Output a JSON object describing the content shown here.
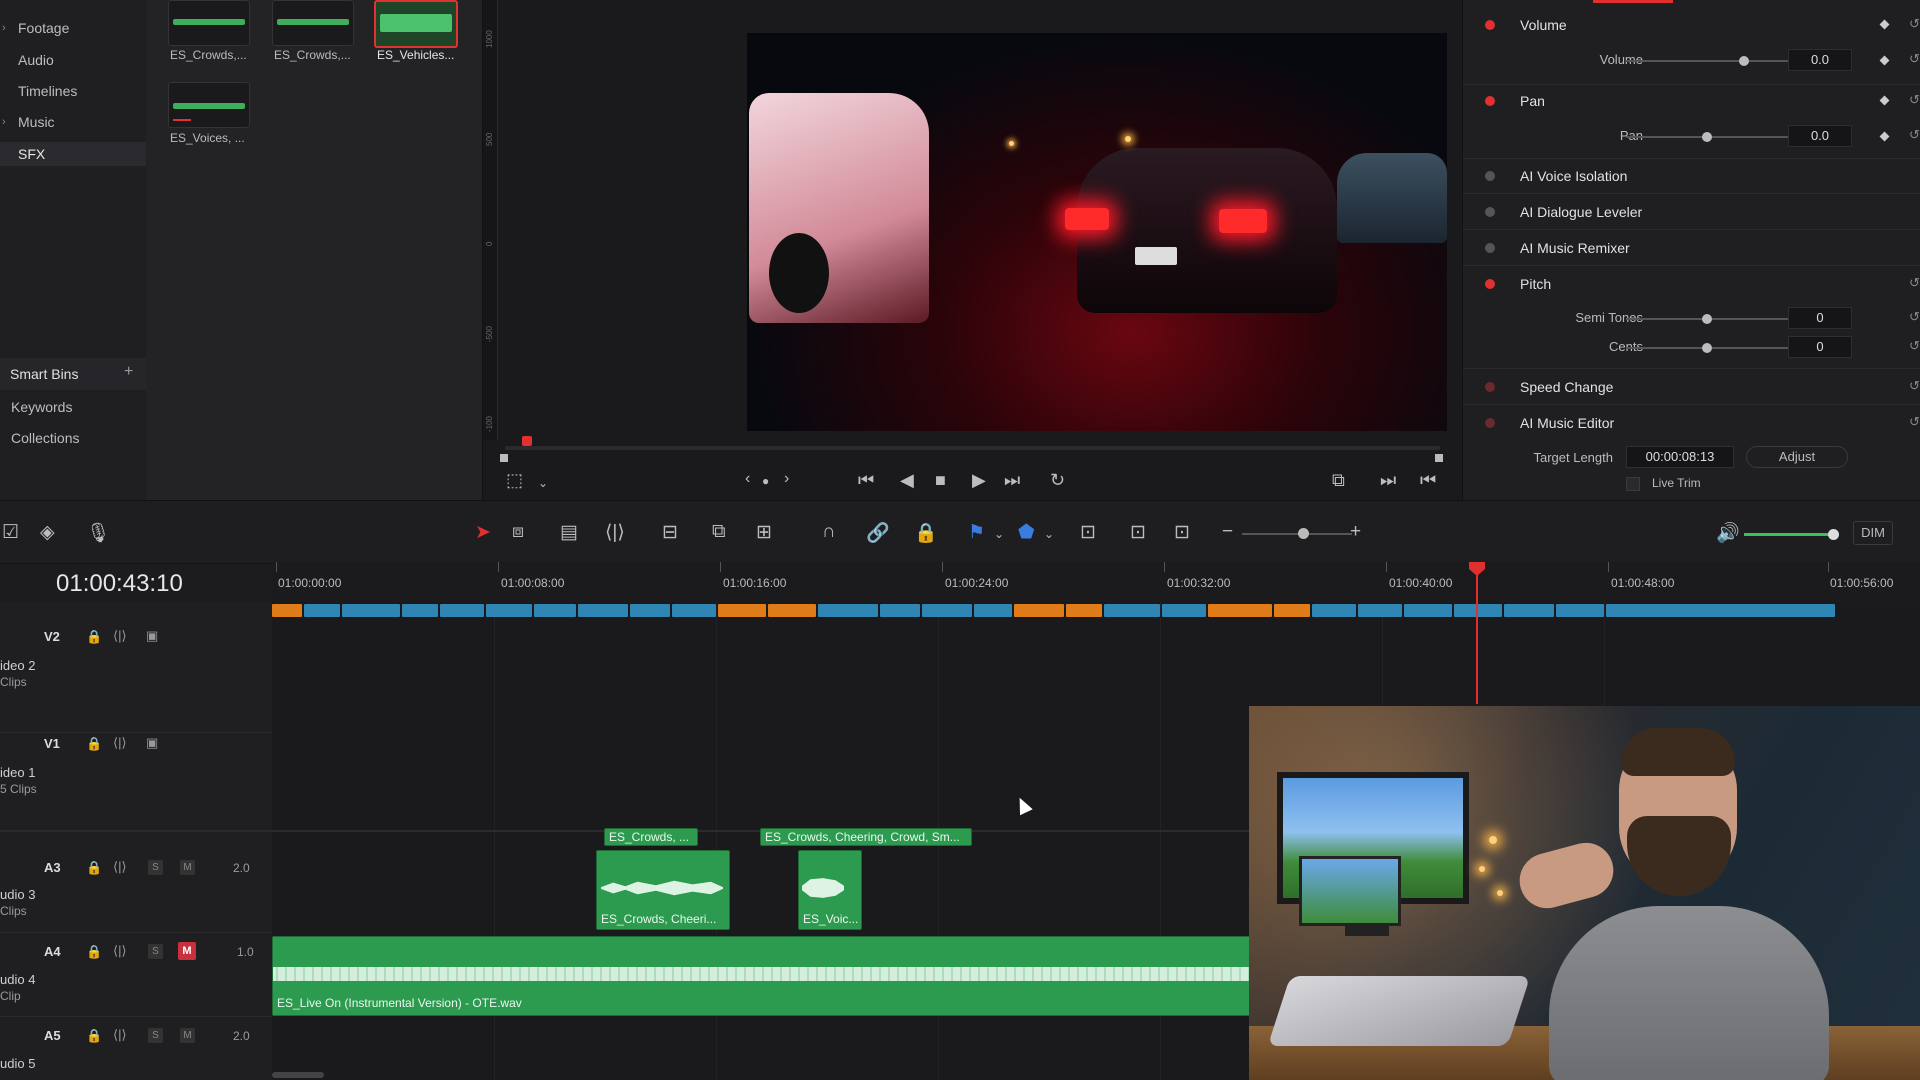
{
  "bins": {
    "items": [
      "Footage",
      "Audio",
      "Timelines",
      "Music",
      "SFX"
    ],
    "smart_bins_title": "Smart Bins",
    "smart_items": [
      "Keywords",
      "Collections"
    ]
  },
  "media": {
    "clips": [
      "ES_Crowds,...",
      "ES_Crowds,...",
      "ES_Vehicles...",
      "ES_Voices, ..."
    ]
  },
  "viewer": {
    "ruler_labels": [
      "1000",
      "500",
      "0",
      "-500",
      "-100"
    ]
  },
  "inspector": {
    "volume": {
      "title": "Volume",
      "param": "Volume",
      "value": "0.0",
      "level": 0.6
    },
    "pan": {
      "title": "Pan",
      "param": "Pan",
      "value": "0.0",
      "level": 0.5
    },
    "ai_voice_isolation": "AI Voice Isolation",
    "ai_dialogue_leveler": "AI Dialogue Leveler",
    "ai_music_remixer": "AI Music Remixer",
    "pitch": {
      "title": "Pitch",
      "semi_label": "Semi Tones",
      "semi_value": "0",
      "cents_label": "Cents",
      "cents_value": "0"
    },
    "speed_change": "Speed Change",
    "ai_music_editor": {
      "title": "AI Music Editor",
      "target_label": "Target Length",
      "target_value": "00:00:08:13",
      "adjust_label": "Adjust",
      "live_trim_label": "Live Trim"
    },
    "accent": "#e03030"
  },
  "toolbar": {
    "dim_label": "DIM"
  },
  "timeline": {
    "timecode": "01:00:43:10",
    "ruler": [
      "01:00:00:00",
      "01:00:08:00",
      "01:00:16:00",
      "01:00:24:00",
      "01:00:32:00",
      "01:00:40:00",
      "01:00:48:00",
      "01:00:56:00"
    ],
    "tracks": [
      {
        "id": "V2",
        "name": "ideo 2",
        "sub": "Clips"
      },
      {
        "id": "V1",
        "name": "ideo 1",
        "sub": "5 Clips"
      },
      {
        "id": "A3",
        "name": "udio 3",
        "sub": "Clips",
        "gain": "2.0"
      },
      {
        "id": "A4",
        "name": "udio 4",
        "sub": "Clip",
        "gain": "1.0",
        "mute": "M"
      },
      {
        "id": "A5",
        "name": "udio 5",
        "sub": "",
        "gain": "2.0"
      }
    ],
    "clips": {
      "a3_top_1": "ES_Crowds, ...",
      "a3_top_2": "ES_Crowds, Cheering, Crowd, Sm...",
      "a3_clip_1": "ES_Crowds, Cheeri...",
      "a3_clip_2": "ES_Voic...",
      "a4_clip": "ES_Live On (Instrumental Version) - OTE.wav"
    },
    "solo_label": "S",
    "mute_label": "M"
  }
}
